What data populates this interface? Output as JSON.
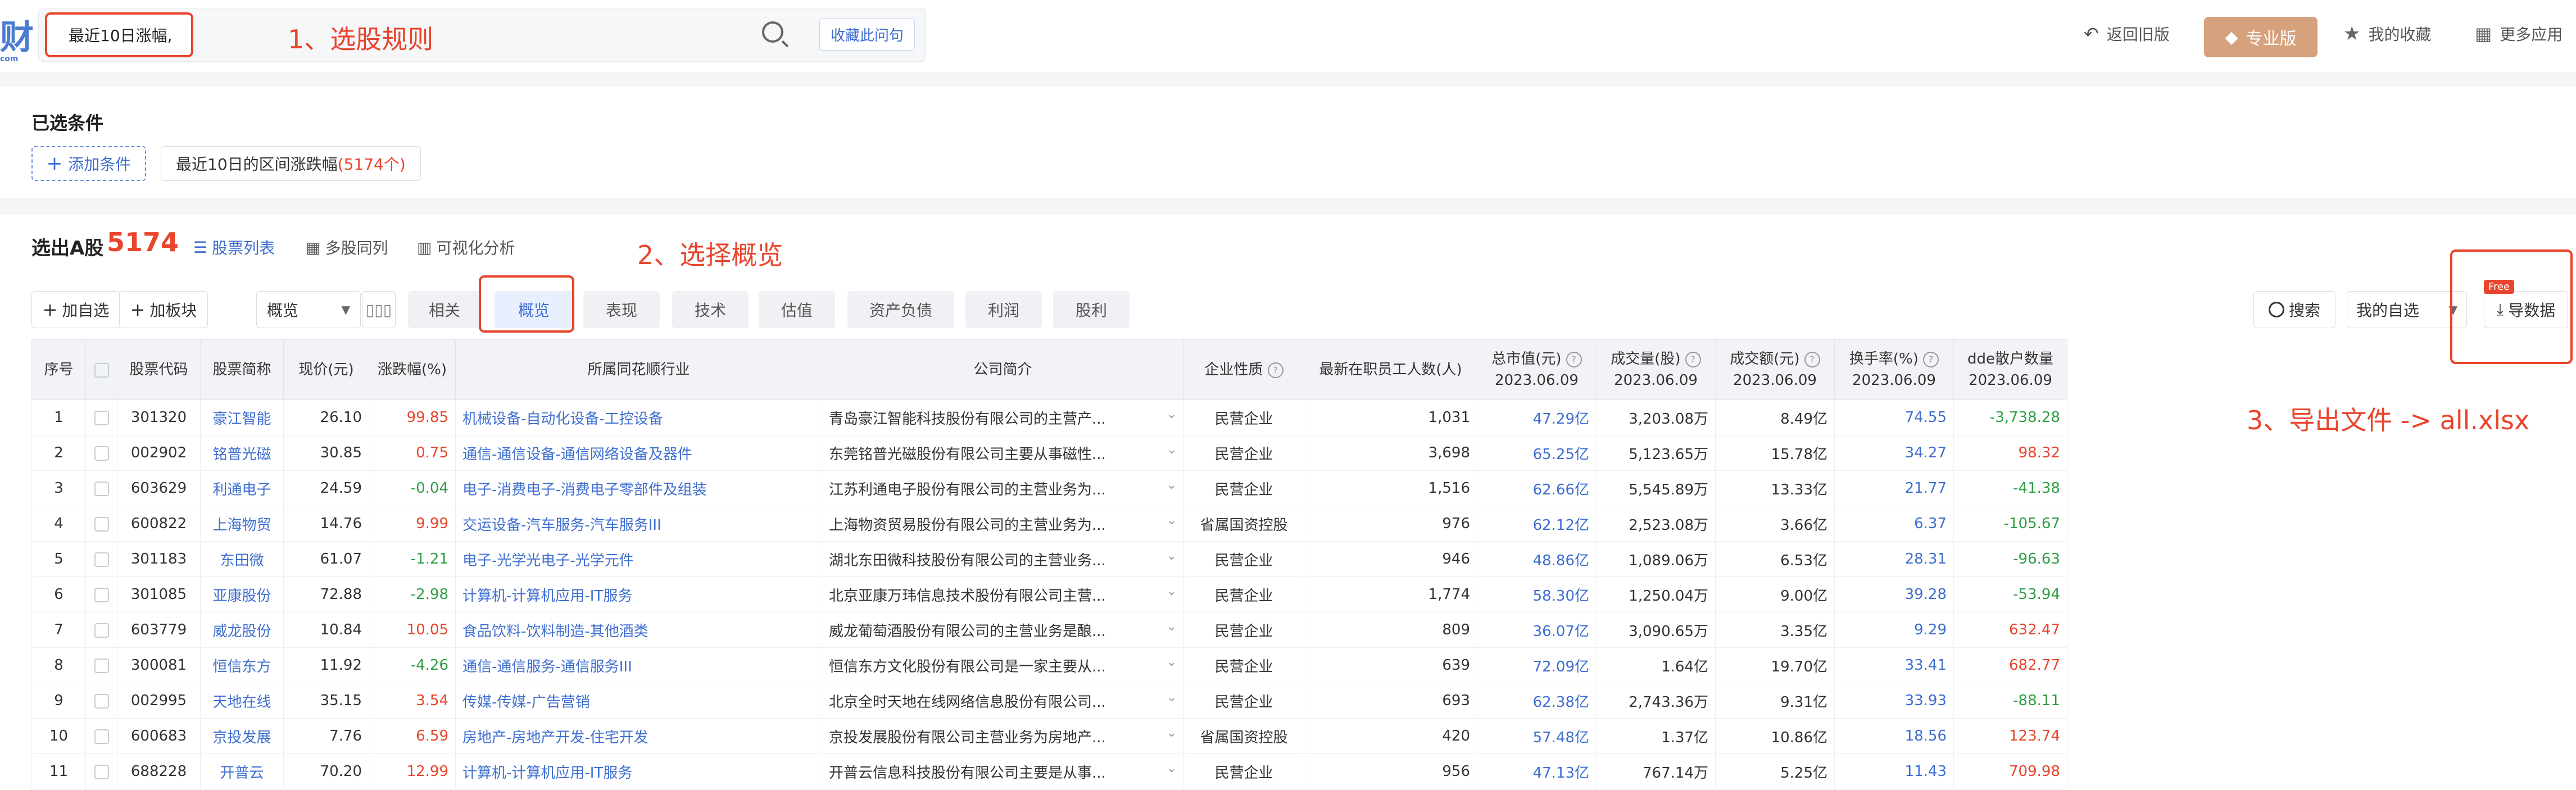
{
  "header": {
    "logo_text": "财",
    "logo_sub": "com",
    "query": "最近10日涨幅,",
    "collect_label": "收藏此问句",
    "back_label": "返回旧版",
    "pro_label": "专业版",
    "favorites_label": "我的收藏",
    "more_label": "更多应用"
  },
  "annotations": {
    "step1": "1、选股规则",
    "step2": "2、选择概览",
    "step3": "3、导出文件 -> all.xlsx"
  },
  "conditions": {
    "title": "已选条件",
    "add_label": "添加条件",
    "chip_label": "最近10日的区间涨跌幅",
    "chip_count": "(5174个)"
  },
  "result": {
    "title": "选出A股",
    "count": "5174",
    "views": [
      "股票列表",
      "多股同列",
      "可视化分析"
    ],
    "add_watch": "加自选",
    "add_sector": "加板块",
    "select_value": "概览",
    "tabs": [
      "相关",
      "概览",
      "表现",
      "技术",
      "估值",
      "资产负债",
      "利润",
      "股利"
    ],
    "search_label": "搜索",
    "my_select": "我的自选",
    "free_badge": "Free",
    "export_label": "导数据"
  },
  "table": {
    "headers": [
      "序号",
      "",
      "股票代码",
      "股票简称",
      "现价(元)",
      "涨跌幅(%)",
      "所属同花顺行业",
      "公司简介",
      "企业性质",
      "最新在职员工人数(人)",
      "总市值(元)",
      "成交量(股)",
      "成交额(元)",
      "换手率(%)",
      "dde散户数量"
    ],
    "date": "2023.06.09",
    "rows": [
      {
        "n": "1",
        "code": "301320",
        "name": "豪江智能",
        "price": "26.10",
        "chg": "99.85",
        "ind": "机械设备-自动化设备-工控设备",
        "intro": "青岛豪江智能科技股份有限公司的主营产...",
        "nature": "民营企业",
        "staff": "1,031",
        "mcap": "47.29亿",
        "vol": "3,203.08万",
        "amt": "8.49亿",
        "turn": "74.55",
        "dde": "-3,738.28"
      },
      {
        "n": "2",
        "code": "002902",
        "name": "铭普光磁",
        "price": "30.85",
        "chg": "0.75",
        "ind": "通信-通信设备-通信网络设备及器件",
        "intro": "东莞铭普光磁股份有限公司主要从事磁性...",
        "nature": "民营企业",
        "staff": "3,698",
        "mcap": "65.25亿",
        "vol": "5,123.65万",
        "amt": "15.78亿",
        "turn": "34.27",
        "dde": "98.32"
      },
      {
        "n": "3",
        "code": "603629",
        "name": "利通电子",
        "price": "24.59",
        "chg": "-0.04",
        "ind": "电子-消费电子-消费电子零部件及组装",
        "intro": "江苏利通电子股份有限公司的主营业务为...",
        "nature": "民营企业",
        "staff": "1,516",
        "mcap": "62.66亿",
        "vol": "5,545.89万",
        "amt": "13.33亿",
        "turn": "21.77",
        "dde": "-41.38"
      },
      {
        "n": "4",
        "code": "600822",
        "name": "上海物贸",
        "price": "14.76",
        "chg": "9.99",
        "ind": "交运设备-汽车服务-汽车服务III",
        "intro": "上海物资贸易股份有限公司的主营业务为...",
        "nature": "省属国资控股",
        "staff": "976",
        "mcap": "62.12亿",
        "vol": "2,523.08万",
        "amt": "3.66亿",
        "turn": "6.37",
        "dde": "-105.67"
      },
      {
        "n": "5",
        "code": "301183",
        "name": "东田微",
        "price": "61.07",
        "chg": "-1.21",
        "ind": "电子-光学光电子-光学元件",
        "intro": "湖北东田微科技股份有限公司的主营业务...",
        "nature": "民营企业",
        "staff": "946",
        "mcap": "48.86亿",
        "vol": "1,089.06万",
        "amt": "6.53亿",
        "turn": "28.31",
        "dde": "-96.63"
      },
      {
        "n": "6",
        "code": "301085",
        "name": "亚康股份",
        "price": "72.88",
        "chg": "-2.98",
        "ind": "计算机-计算机应用-IT服务",
        "intro": "北京亚康万玮信息技术股份有限公司主营...",
        "nature": "民营企业",
        "staff": "1,774",
        "mcap": "58.30亿",
        "vol": "1,250.04万",
        "amt": "9.00亿",
        "turn": "39.28",
        "dde": "-53.94"
      },
      {
        "n": "7",
        "code": "603779",
        "name": "威龙股份",
        "price": "10.84",
        "chg": "10.05",
        "ind": "食品饮料-饮料制造-其他酒类",
        "intro": "威龙葡萄酒股份有限公司的主营业务是酿...",
        "nature": "民营企业",
        "staff": "809",
        "mcap": "36.07亿",
        "vol": "3,090.65万",
        "amt": "3.35亿",
        "turn": "9.29",
        "dde": "632.47"
      },
      {
        "n": "8",
        "code": "300081",
        "name": "恒信东方",
        "price": "11.92",
        "chg": "-4.26",
        "ind": "通信-通信服务-通信服务III",
        "intro": "恒信东方文化股份有限公司是一家主要从...",
        "nature": "民营企业",
        "staff": "639",
        "mcap": "72.09亿",
        "vol": "1.64亿",
        "amt": "19.70亿",
        "turn": "33.41",
        "dde": "682.77"
      },
      {
        "n": "9",
        "code": "002995",
        "name": "天地在线",
        "price": "35.15",
        "chg": "3.54",
        "ind": "传媒-传媒-广告营销",
        "intro": "北京全时天地在线网络信息股份有限公司...",
        "nature": "民营企业",
        "staff": "693",
        "mcap": "62.38亿",
        "vol": "2,743.36万",
        "amt": "9.31亿",
        "turn": "33.93",
        "dde": "-88.11"
      },
      {
        "n": "10",
        "code": "600683",
        "name": "京投发展",
        "price": "7.76",
        "chg": "6.59",
        "ind": "房地产-房地产开发-住宅开发",
        "intro": "京投发展股份有限公司主营业务为房地产...",
        "nature": "省属国资控股",
        "staff": "420",
        "mcap": "57.48亿",
        "vol": "1.37亿",
        "amt": "10.86亿",
        "turn": "18.56",
        "dde": "123.74"
      },
      {
        "n": "11",
        "code": "688228",
        "name": "开普云",
        "price": "70.20",
        "chg": "12.99",
        "ind": "计算机-计算机应用-IT服务",
        "intro": "开普云信息科技股份有限公司主要是从事...",
        "nature": "民营企业",
        "staff": "956",
        "mcap": "47.13亿",
        "vol": "767.14万",
        "amt": "5.25亿",
        "turn": "11.43",
        "dde": "709.98"
      }
    ]
  },
  "colors": {
    "accent": "#3e6ed0",
    "annotation": "#e8452c",
    "up": "#e8452c",
    "down": "#2f9e44",
    "pro": "#d6a27d"
  }
}
